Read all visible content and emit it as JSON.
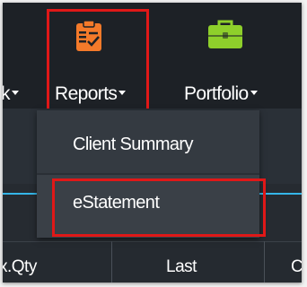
{
  "nav": {
    "items": [
      {
        "label": "k",
        "icon": "unknown-icon",
        "has_dropdown": true
      },
      {
        "label": "Reports",
        "icon": "report-checklist-icon",
        "has_dropdown": true,
        "active": true
      },
      {
        "label": "Portfolio",
        "icon": "briefcase-icon",
        "has_dropdown": true
      }
    ]
  },
  "reports_menu": {
    "items": [
      {
        "label": "Client Summary"
      },
      {
        "label": "eStatement",
        "highlighted": true
      }
    ]
  },
  "grid": {
    "columns": [
      {
        "label": "x.Qty"
      },
      {
        "label": "Last"
      },
      {
        "label": "C"
      }
    ]
  },
  "colors": {
    "nav_bg": "#1d2126",
    "reports_icon": "#f47a2a",
    "portfolio_icon": "#8ecf2b",
    "accent": "#35b6e8",
    "highlight": "#e01818"
  }
}
